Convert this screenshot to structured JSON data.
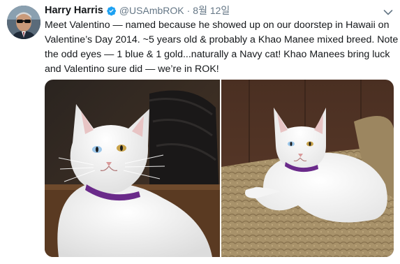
{
  "tweet": {
    "display_name": "Harry Harris",
    "handle": "@USAmbROK",
    "separator": "·",
    "timestamp": "8월 12일",
    "text_lines": [
      "Meet Valentino — named because he showed up on our doorstep in Hawaii on",
      "Valentine’s Day 2014. ~5 years old & probably a Khao Manee mixed breed. Note",
      "the odd eyes — 1 blue & 1 gold...naturally a Navy cat!  Khao Manees bring luck",
      "and Valentino sure did — we’re in ROK!"
    ]
  },
  "icons": {
    "verified": "verified-badge-icon",
    "menu": "chevron-down-icon"
  },
  "colors": {
    "text": "#14171a",
    "secondary": "#657786",
    "verified": "#1da1f2"
  }
}
